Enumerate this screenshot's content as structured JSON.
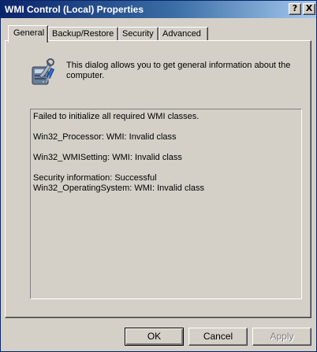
{
  "window": {
    "title": "WMI Control (Local) Properties",
    "help_glyph": "?",
    "close_glyph": "X"
  },
  "tabs": [
    {
      "label": "General",
      "active": true
    },
    {
      "label": "Backup/Restore",
      "active": false
    },
    {
      "label": "Security",
      "active": false
    },
    {
      "label": "Advanced",
      "active": false
    }
  ],
  "general": {
    "icon": "computer-tools-icon",
    "intro": "This dialog allows you to get general information about the computer.",
    "status_lines": [
      "Failed to initialize all required WMI classes.",
      "",
      "Win32_Processor:  WMI: Invalid class",
      "",
      "Win32_WMISetting:  WMI: Invalid class",
      "",
      "Security information:  Successful",
      "Win32_OperatingSystem:  WMI: Invalid class"
    ]
  },
  "buttons": {
    "ok": "OK",
    "cancel": "Cancel",
    "apply": "Apply",
    "apply_enabled": false
  },
  "colors": {
    "face": "#d4d0c8",
    "title_start": "#0a246a",
    "title_end": "#a6caf0",
    "disabled_text": "#808080"
  }
}
